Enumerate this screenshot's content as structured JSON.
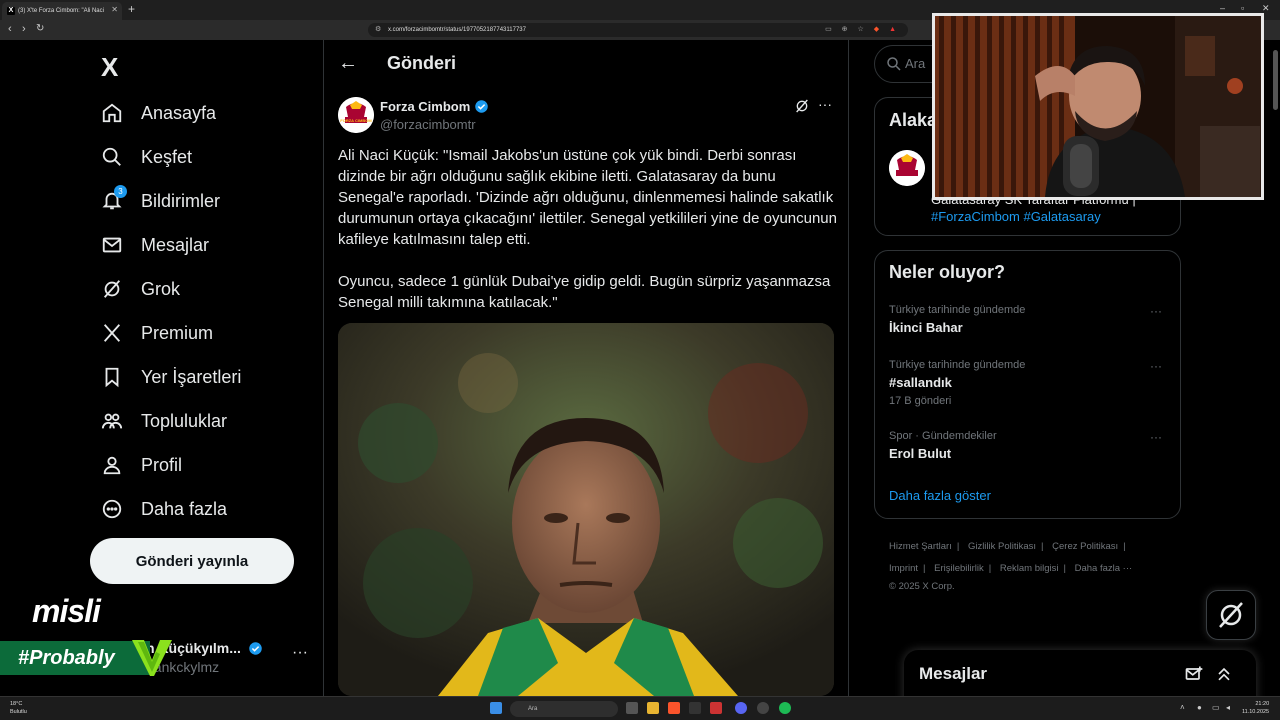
{
  "browser": {
    "tab_title": "(3) X'te Forza Cimbom: \"Ali Naci",
    "tab_favicon": "X",
    "url": "x.com/forzacimbomtr/status/1977052187743117737",
    "new_tab_glyph": "+",
    "window_controls": [
      "–",
      "▫",
      "✕"
    ]
  },
  "nav": {
    "logo": "X",
    "items": [
      {
        "label": "Anasayfa",
        "icon": "home-icon"
      },
      {
        "label": "Keşfet",
        "icon": "search-icon"
      },
      {
        "label": "Bildirimler",
        "icon": "bell-icon",
        "badge": "3"
      },
      {
        "label": "Mesajlar",
        "icon": "mail-icon"
      },
      {
        "label": "Grok",
        "icon": "grok-icon"
      },
      {
        "label": "Premium",
        "icon": "x-premium-icon"
      },
      {
        "label": "Yer İşaretleri",
        "icon": "bookmark-icon"
      },
      {
        "label": "Topluluklar",
        "icon": "communities-icon"
      },
      {
        "label": "Profil",
        "icon": "profile-icon"
      },
      {
        "label": "Daha fazla",
        "icon": "more-circle-icon"
      }
    ],
    "post_button": "Gönderi yayınla",
    "account": {
      "name": "h Küçükyılm...",
      "handle": "aankckylmz",
      "more": "···"
    }
  },
  "overlays": {
    "sponsor": "misli",
    "hashtag": "#Probably"
  },
  "post": {
    "page_title": "Gönderi",
    "author_name": "Forza Cimbom",
    "author_handle": "@forzacimbomtr",
    "avatar_text": "FORZA CIMBOM",
    "more": "···",
    "text": "Ali Naci Küçük: \"Ismail Jakobs'un üstüne çok yük bindi. Derbi sonrası dizinde bir ağrı olduğunu sağlık ekibine iletti. Galatasaray da bunu Senegal'e raporladı. 'Dizinde ağrı olduğunu, dinlenmemesi halinde sakatlık durumunun ortaya çıkacağını' ilettiler. Senegal yetkilileri yine de oyuncunun kafileye katılmasını talep etti.\n\nOyuncu, sadece 1 günlük Dubai'ye gidip geldi. Bugün sürpriz yaşanmazsa Senegal milli takımına katılacak.\""
  },
  "sidebar": {
    "search_placeholder": "Ara",
    "related_title": "Alaka",
    "related_bio": "Galatasaray SK Taraftar Platformu |",
    "related_tags": "#ForzaCimbom #Galatasaray",
    "trends_title": "Neler oluyor?",
    "trends": [
      {
        "context": "Türkiye tarihinde gündemde",
        "name": "İkinci Bahar",
        "count": ""
      },
      {
        "context": "Türkiye tarihinde gündemde",
        "name": "#sallandık",
        "count": "17 B gönderi"
      },
      {
        "context": "Spor · Gündemdekiler",
        "name": "Erol Bulut",
        "count": ""
      }
    ],
    "trend_more": "···",
    "show_more": "Daha fazla göster",
    "footer": [
      "Hizmet Şartları",
      "Gizlilik Politikası",
      "Çerez Politikası",
      "Imprint",
      "Erişilebilirlik",
      "Reklam bilgisi",
      "Daha fazla ···",
      "© 2025 X Corp."
    ],
    "messages_title": "Mesajlar"
  },
  "taskbar": {
    "weather_temp": "18°C",
    "weather_desc": "Bulutlu",
    "search": "Ara",
    "time": "21:20",
    "date": "11.10.2025"
  },
  "colors": {
    "accent": "#1d9bf0",
    "bg": "#000000",
    "border": "#2f3336",
    "muted": "#71767b"
  }
}
